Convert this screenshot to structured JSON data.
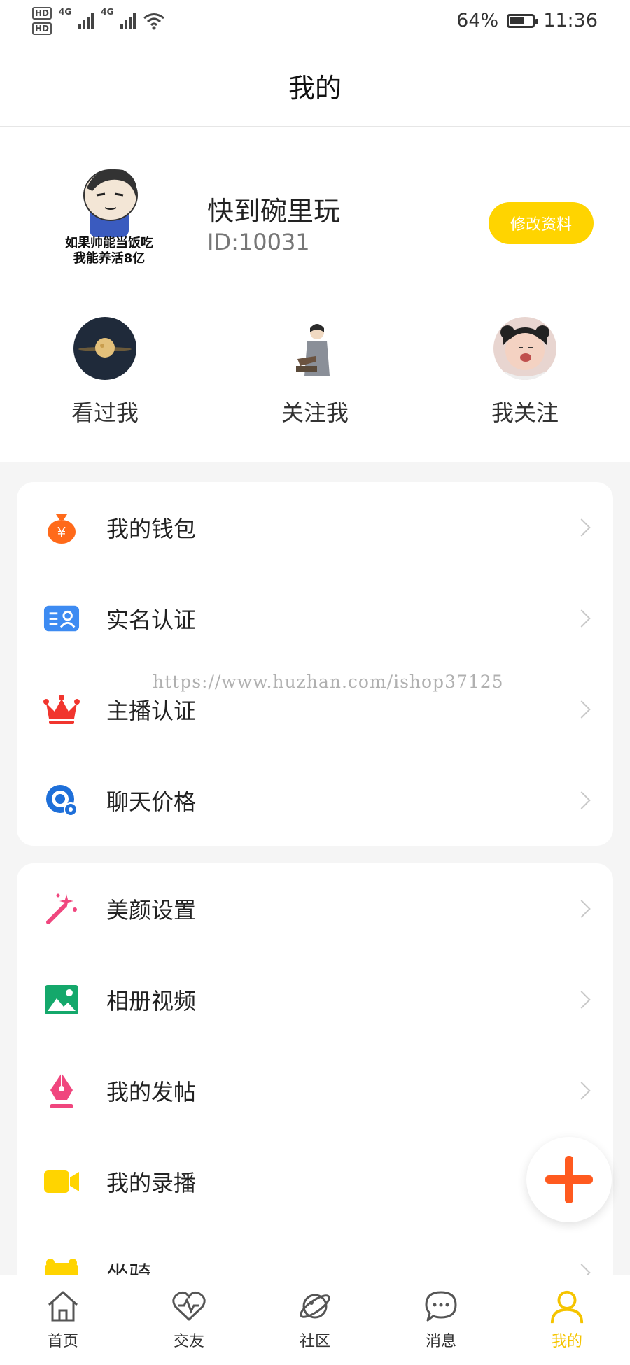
{
  "status_bar": {
    "hd1": "HD",
    "hd2": "HD",
    "net1": "4G",
    "net2": "4G",
    "battery": "64%",
    "battery_level": 0.64,
    "time": "11:36"
  },
  "header": {
    "title": "我的"
  },
  "profile": {
    "avatar_caption_1": "如果帅能当饭吃",
    "avatar_caption_2": "我能养活8亿",
    "username": "快到碗里玩",
    "id_text": "ID:10031",
    "edit_label": "修改资料"
  },
  "stats": [
    {
      "label": "看过我"
    },
    {
      "label": "关注我"
    },
    {
      "label": "我关注"
    }
  ],
  "menu_group_1": [
    {
      "label": "我的钱包",
      "icon": "money-bag-icon"
    },
    {
      "label": "实名认证",
      "icon": "id-card-icon"
    },
    {
      "label": "主播认证",
      "icon": "crown-icon"
    },
    {
      "label": "聊天价格",
      "icon": "chat-price-icon"
    }
  ],
  "menu_group_2": [
    {
      "label": "美颜设置",
      "icon": "magic-wand-icon"
    },
    {
      "label": "相册视频",
      "icon": "photo-album-icon"
    },
    {
      "label": "我的发帖",
      "icon": "pen-icon"
    },
    {
      "label": "我的录播",
      "icon": "video-camera-icon"
    },
    {
      "label": "坐骑",
      "icon": "mount-icon"
    }
  ],
  "watermark": "https://www.huzhan.com/ishop37125",
  "tabs": [
    {
      "label": "首页",
      "icon": "home-icon"
    },
    {
      "label": "交友",
      "icon": "heart-pulse-icon"
    },
    {
      "label": "社区",
      "icon": "planet-icon"
    },
    {
      "label": "消息",
      "icon": "message-icon"
    },
    {
      "label": "我的",
      "icon": "user-icon",
      "active": true
    }
  ],
  "colors": {
    "accent": "#ffd400",
    "active_tab": "#f5c400",
    "fab_plus": "#ff5a1f"
  }
}
